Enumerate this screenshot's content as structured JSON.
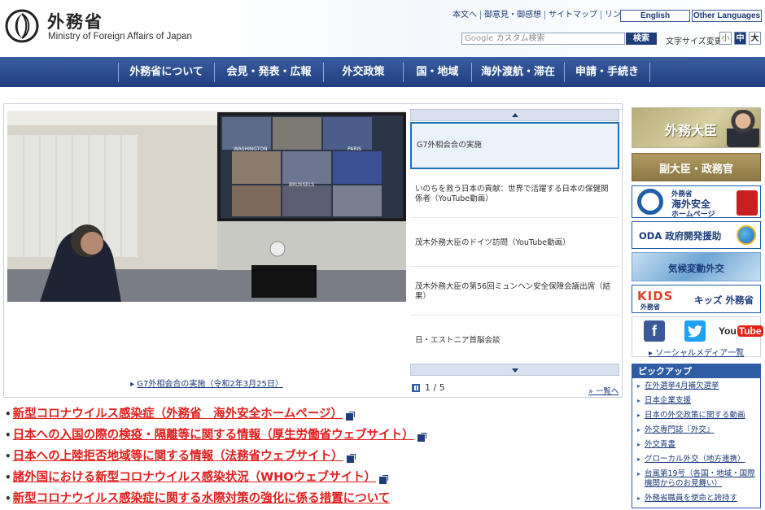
{
  "header": {
    "logo_ja": "外務省",
    "logo_en": "Ministry of Foreign Affairs of Japan",
    "utility_links": [
      "本文へ",
      "御意見・御感想",
      "サイトマップ",
      "リンク集"
    ],
    "lang_english": "English",
    "lang_other": "Other Languages",
    "search_placeholder_brand": "Google",
    "search_placeholder": "カスタム検索",
    "search_button": "検索",
    "fontsize_label": "文字サイズ変更",
    "fontsize_small": "小",
    "fontsize_mid": "中",
    "fontsize_large": "大"
  },
  "nav": {
    "items": [
      "外務省について",
      "会見・発表・広報",
      "外交政策",
      "国・地域",
      "海外渡航・滞在",
      "申請・手続き"
    ]
  },
  "slider": {
    "caption": "G7外相会合の実施（令和2年3月25日）",
    "items": [
      "G7外相会合の実施",
      "いのちを救う日本の貢献：世界で活躍する日本の保健関係者（YouTube動画）",
      "茂木外務大臣のドイツ訪問（YouTube動画）",
      "茂木外務大臣の第56回ミュンヘン安全保障会議出席（結果）",
      "日・エストニア首脳会談"
    ],
    "page_indicator": "1 / 5",
    "all_link": "一覧へ",
    "photo_labels": [
      "WASHINGTON",
      "PARIS",
      "BRUSSELS"
    ]
  },
  "covid_links": [
    "新型コロナウイルス感染症（外務省　海外安全ホームページ）",
    "日本への入国の際の検疫・隔離等に関する情報（厚生労働省ウェブサイト）",
    "日本への上陸拒否地域等に関する情報（法務省ウェブサイト）",
    "諸外国における新型コロナウイルス感染状況（WHOウェブサイト）",
    "新型コロナウイルス感染症に関する水際対策の強化に係る措置について"
  ],
  "banners": {
    "minister": "外務大臣",
    "vice": "副大臣・政務官",
    "anzen_l1": "外務省",
    "anzen_l2": "海外安全",
    "anzen_l3": "ホームページ",
    "oda": "ODA 政府開発援助",
    "climate": "気候変動外交",
    "kids_logo": "KIDS",
    "kids_sub": "外務省",
    "kids_text": "キッズ 外務省"
  },
  "social": {
    "facebook": "f",
    "twitter": "t",
    "youtube_a": "You",
    "youtube_b": "Tube",
    "link": "ソーシャルメディア一覧"
  },
  "pickup": {
    "title": "ピックアップ",
    "items": [
      "在外選挙4月補欠選挙",
      "日本企業支援",
      "日本の外交政策に関する動画",
      "外交専門誌『外交』",
      "外交青書",
      "グローカル外交（地方連携）",
      "台風第19号（各国・地域・国際機関からのお見舞い）",
      "外務省職員を使命と誇持す"
    ]
  }
}
